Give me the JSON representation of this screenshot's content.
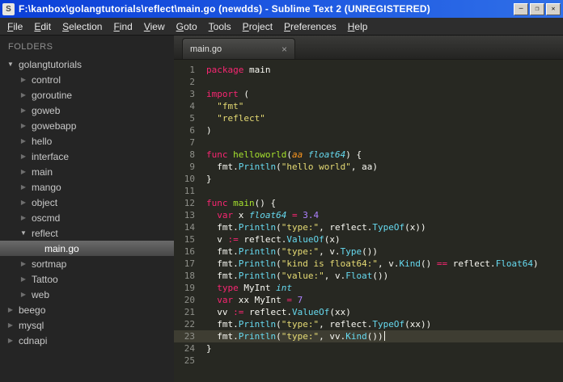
{
  "window": {
    "title": "F:\\kanbox\\golangtutorials\\reflect\\main.go (newdds) - Sublime Text 2 (UNREGISTERED)",
    "app_icon": "S",
    "controls": [
      {
        "name": "minimize",
        "glyph": "─"
      },
      {
        "name": "maximize",
        "glyph": "❐"
      },
      {
        "name": "close",
        "glyph": "✕"
      }
    ]
  },
  "menu": {
    "items": [
      "File",
      "Edit",
      "Selection",
      "Find",
      "View",
      "Goto",
      "Tools",
      "Project",
      "Preferences",
      "Help"
    ]
  },
  "sidebar": {
    "header": "FOLDERS",
    "tree": [
      {
        "label": "golangtutorials",
        "depth": 0,
        "type": "folder",
        "expanded": true
      },
      {
        "label": "control",
        "depth": 1,
        "type": "folder",
        "expanded": false
      },
      {
        "label": "goroutine",
        "depth": 1,
        "type": "folder",
        "expanded": false
      },
      {
        "label": "goweb",
        "depth": 1,
        "type": "folder",
        "expanded": false
      },
      {
        "label": "gowebapp",
        "depth": 1,
        "type": "folder",
        "expanded": false
      },
      {
        "label": "hello",
        "depth": 1,
        "type": "folder",
        "expanded": false
      },
      {
        "label": "interface",
        "depth": 1,
        "type": "folder",
        "expanded": false
      },
      {
        "label": "main",
        "depth": 1,
        "type": "folder",
        "expanded": false
      },
      {
        "label": "mango",
        "depth": 1,
        "type": "folder",
        "expanded": false
      },
      {
        "label": "object",
        "depth": 1,
        "type": "folder",
        "expanded": false
      },
      {
        "label": "oscmd",
        "depth": 1,
        "type": "folder",
        "expanded": false
      },
      {
        "label": "reflect",
        "depth": 1,
        "type": "folder",
        "expanded": true
      },
      {
        "label": "main.go",
        "depth": 2,
        "type": "file",
        "selected": true
      },
      {
        "label": "sortmap",
        "depth": 1,
        "type": "folder",
        "expanded": false
      },
      {
        "label": "Tattoo",
        "depth": 1,
        "type": "folder",
        "expanded": false
      },
      {
        "label": "web",
        "depth": 1,
        "type": "folder",
        "expanded": false
      },
      {
        "label": "beego",
        "depth": 0,
        "type": "folder",
        "expanded": false
      },
      {
        "label": "mysql",
        "depth": 0,
        "type": "folder",
        "expanded": false
      },
      {
        "label": "cdnapi",
        "depth": 0,
        "type": "folder",
        "expanded": false
      }
    ]
  },
  "editor": {
    "tab": {
      "label": "main.go",
      "close": "×"
    },
    "cursor_line": 23,
    "colors": {
      "editor_background": "#272822",
      "keyword": "#f92672",
      "function_name": "#a6e22e",
      "type": "#66d9ef",
      "parameter": "#fd971f",
      "string": "#e6db74",
      "number": "#ae81ff",
      "library_call": "#66d9ef",
      "plain_text": "#f8f8f2",
      "line_number": "#8f908a",
      "current_line": "#3e3d32",
      "titlebar_blue": "#0b3fd8",
      "sidebar_background": "#252525"
    },
    "lines": [
      [
        [
          "kw",
          "package"
        ],
        [
          "pl",
          " main"
        ]
      ],
      [],
      [
        [
          "kw",
          "import"
        ],
        [
          "pl",
          " ("
        ]
      ],
      [
        [
          "pl",
          "  "
        ],
        [
          "str",
          "\"fmt\""
        ]
      ],
      [
        [
          "pl",
          "  "
        ],
        [
          "str",
          "\"reflect\""
        ]
      ],
      [
        [
          "pl",
          ")"
        ]
      ],
      [],
      [
        [
          "kw",
          "func"
        ],
        [
          "pl",
          " "
        ],
        [
          "fn",
          "helloworld"
        ],
        [
          "pl",
          "("
        ],
        [
          "par",
          "aa"
        ],
        [
          "pl",
          " "
        ],
        [
          "typ",
          "float64"
        ],
        [
          "pl",
          ") {"
        ]
      ],
      [
        [
          "pl",
          "  fmt."
        ],
        [
          "call",
          "Println"
        ],
        [
          "pl",
          "("
        ],
        [
          "str",
          "\"hello world\""
        ],
        [
          "pl",
          ", aa)"
        ]
      ],
      [
        [
          "pl",
          "}"
        ]
      ],
      [],
      [
        [
          "kw",
          "func"
        ],
        [
          "pl",
          " "
        ],
        [
          "fn",
          "main"
        ],
        [
          "pl",
          "() {"
        ]
      ],
      [
        [
          "pl",
          "  "
        ],
        [
          "kw",
          "var"
        ],
        [
          "pl",
          " x "
        ],
        [
          "typ",
          "float64"
        ],
        [
          "pl",
          " "
        ],
        [
          "op",
          "="
        ],
        [
          "pl",
          " "
        ],
        [
          "num",
          "3.4"
        ]
      ],
      [
        [
          "pl",
          "  fmt."
        ],
        [
          "call",
          "Println"
        ],
        [
          "pl",
          "("
        ],
        [
          "str",
          "\"type:\""
        ],
        [
          "pl",
          ", reflect."
        ],
        [
          "call",
          "TypeOf"
        ],
        [
          "pl",
          "(x))"
        ]
      ],
      [
        [
          "pl",
          "  v "
        ],
        [
          "op",
          ":="
        ],
        [
          "pl",
          " reflect."
        ],
        [
          "call",
          "ValueOf"
        ],
        [
          "pl",
          "(x)"
        ]
      ],
      [
        [
          "pl",
          "  fmt."
        ],
        [
          "call",
          "Println"
        ],
        [
          "pl",
          "("
        ],
        [
          "str",
          "\"type:\""
        ],
        [
          "pl",
          ", v."
        ],
        [
          "call",
          "Type"
        ],
        [
          "pl",
          "())"
        ]
      ],
      [
        [
          "pl",
          "  fmt."
        ],
        [
          "call",
          "Println"
        ],
        [
          "pl",
          "("
        ],
        [
          "str",
          "\"kind is float64:\""
        ],
        [
          "pl",
          ", v."
        ],
        [
          "call",
          "Kind"
        ],
        [
          "pl",
          "() "
        ],
        [
          "op",
          "=="
        ],
        [
          "pl",
          " reflect."
        ],
        [
          "call",
          "Float64"
        ],
        [
          "pl",
          ")"
        ]
      ],
      [
        [
          "pl",
          "  fmt."
        ],
        [
          "call",
          "Println"
        ],
        [
          "pl",
          "("
        ],
        [
          "str",
          "\"value:\""
        ],
        [
          "pl",
          ", v."
        ],
        [
          "call",
          "Float"
        ],
        [
          "pl",
          "())"
        ]
      ],
      [
        [
          "pl",
          "  "
        ],
        [
          "kw",
          "type"
        ],
        [
          "pl",
          " MyInt "
        ],
        [
          "typ",
          "int"
        ]
      ],
      [
        [
          "pl",
          "  "
        ],
        [
          "kw",
          "var"
        ],
        [
          "pl",
          " xx MyInt "
        ],
        [
          "op",
          "="
        ],
        [
          "pl",
          " "
        ],
        [
          "num",
          "7"
        ]
      ],
      [
        [
          "pl",
          "  vv "
        ],
        [
          "op",
          ":="
        ],
        [
          "pl",
          " reflect."
        ],
        [
          "call",
          "ValueOf"
        ],
        [
          "pl",
          "(xx)"
        ]
      ],
      [
        [
          "pl",
          "  fmt."
        ],
        [
          "call",
          "Println"
        ],
        [
          "pl",
          "("
        ],
        [
          "str",
          "\"type:\""
        ],
        [
          "pl",
          ", reflect."
        ],
        [
          "call",
          "TypeOf"
        ],
        [
          "pl",
          "(xx))"
        ]
      ],
      [
        [
          "pl",
          "  fmt."
        ],
        [
          "call",
          "Println"
        ],
        [
          "pl",
          "("
        ],
        [
          "str",
          "\"type:\""
        ],
        [
          "pl",
          ", vv."
        ],
        [
          "call",
          "Kind"
        ],
        [
          "pl",
          "())"
        ]
      ],
      [
        [
          "pl",
          "}"
        ]
      ],
      []
    ]
  }
}
